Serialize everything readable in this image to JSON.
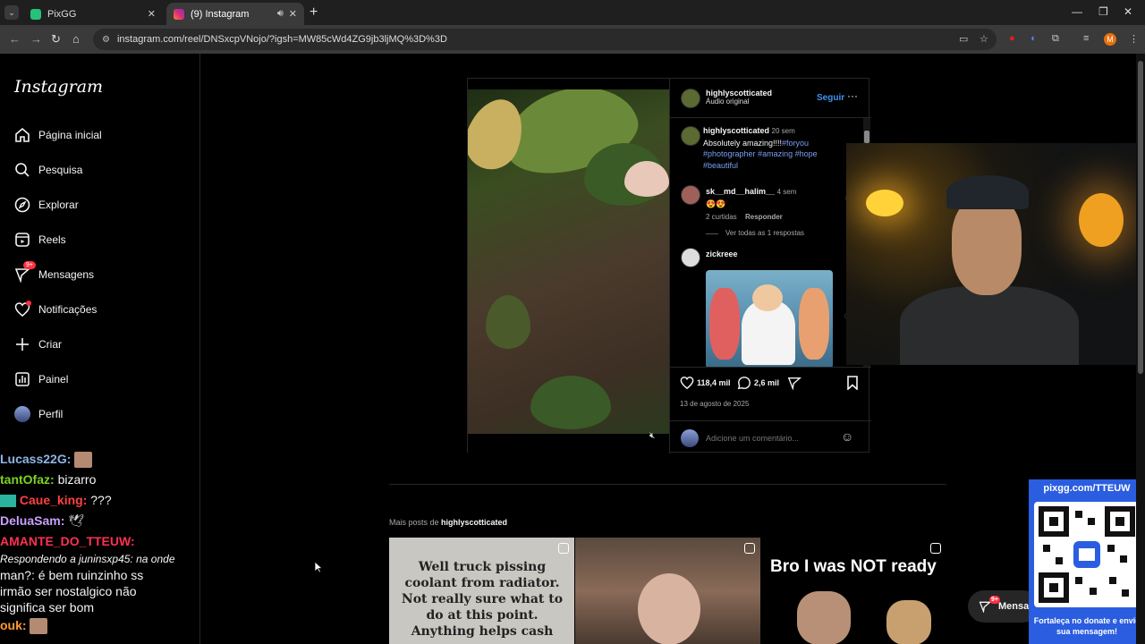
{
  "browser": {
    "tabs": [
      {
        "label": "PixGG",
        "active": false
      },
      {
        "label": "(9) Instagram",
        "active": true
      }
    ],
    "url": "instagram.com/reel/DNSxcpVNojo/?igsh=MW85cWd4ZG9jb3ljMQ%3D%3D",
    "profile_initial": "M"
  },
  "sidebar": {
    "logo": "Instagram",
    "items": [
      {
        "label": "Página inicial",
        "icon": "home-icon"
      },
      {
        "label": "Pesquisa",
        "icon": "search-icon"
      },
      {
        "label": "Explorar",
        "icon": "compass-icon"
      },
      {
        "label": "Reels",
        "icon": "reels-icon"
      },
      {
        "label": "Mensagens",
        "icon": "messenger-icon",
        "badge": "9+"
      },
      {
        "label": "Notificações",
        "icon": "heart-icon"
      },
      {
        "label": "Criar",
        "icon": "plus-icon"
      },
      {
        "label": "Painel",
        "icon": "dashboard-icon"
      },
      {
        "label": "Perfil",
        "icon": "avatar-icon"
      }
    ]
  },
  "chat": [
    {
      "user": "Lucass22G:",
      "color": "#8fb4e8",
      "text": ""
    },
    {
      "user": "tantOfaz:",
      "color": "#7ed321",
      "text": "bizarro"
    },
    {
      "user": "Caue_king:",
      "color": "#ff4040",
      "text": "???"
    },
    {
      "user": "DeluaSam:",
      "color": "#c9a0ff",
      "text": ""
    },
    {
      "user": "AMANTE_DO_TTEUW:",
      "color": "#ff3050",
      "text": ""
    },
    {
      "user": "",
      "color": "#ffffff",
      "text": "Respondendo a juninsxp45: na onde"
    },
    {
      "user": "",
      "color": "#ffffff",
      "text": "man?: é bem ruinzinho ss"
    },
    {
      "user": "",
      "color": "#ffffff",
      "text": "irmão ser nostalgico não"
    },
    {
      "user": "",
      "color": "#ffffff",
      "text": "significa ser bom"
    },
    {
      "user": "ouk:",
      "color": "#ff9933",
      "text": ""
    }
  ],
  "post": {
    "author": "highlyscotticated",
    "audio": "Áudio original",
    "follow_label": "Seguir",
    "caption": {
      "user": "highlyscotticated",
      "time": "20 sem",
      "text": "Absolutely amazing!!!!",
      "tags": [
        "#foryou",
        "#photographer",
        "#amazing",
        "#hope",
        "#beautiful"
      ]
    },
    "comments": [
      {
        "user": "sk__md__halim__",
        "time": "4 sem",
        "text": "😍😍",
        "likes": "2 curtidas",
        "reply": "Responder",
        "view_replies": "Ver todas as 1 respostas"
      },
      {
        "user": "zickreee",
        "time": "",
        "text": ""
      }
    ],
    "likes": "118,4 mil",
    "comments_count": "2,6 mil",
    "date": "13 de agosto de 2025",
    "add_comment_placeholder": "Adicione um comentário..."
  },
  "more_posts": {
    "prefix": "Mais posts de",
    "author": "highlyscotticated",
    "thumbs": [
      {
        "text": "Well truck pissing coolant from radiator. Not really sure what to do at this point. Anything helps cash app"
      },
      {
        "text": ""
      },
      {
        "text": "Bro I was NOT ready"
      }
    ]
  },
  "messages_pill": {
    "label": "Mensa",
    "badge": "9+"
  },
  "overlay": {
    "url": "pixgg.com/TTEUW",
    "cta": "Fortaleça no donate e envie sua mensagem!"
  },
  "colors": {
    "accent": "#4193ef",
    "badge": "#ff3040",
    "qr_panel": "#2b5de0"
  }
}
